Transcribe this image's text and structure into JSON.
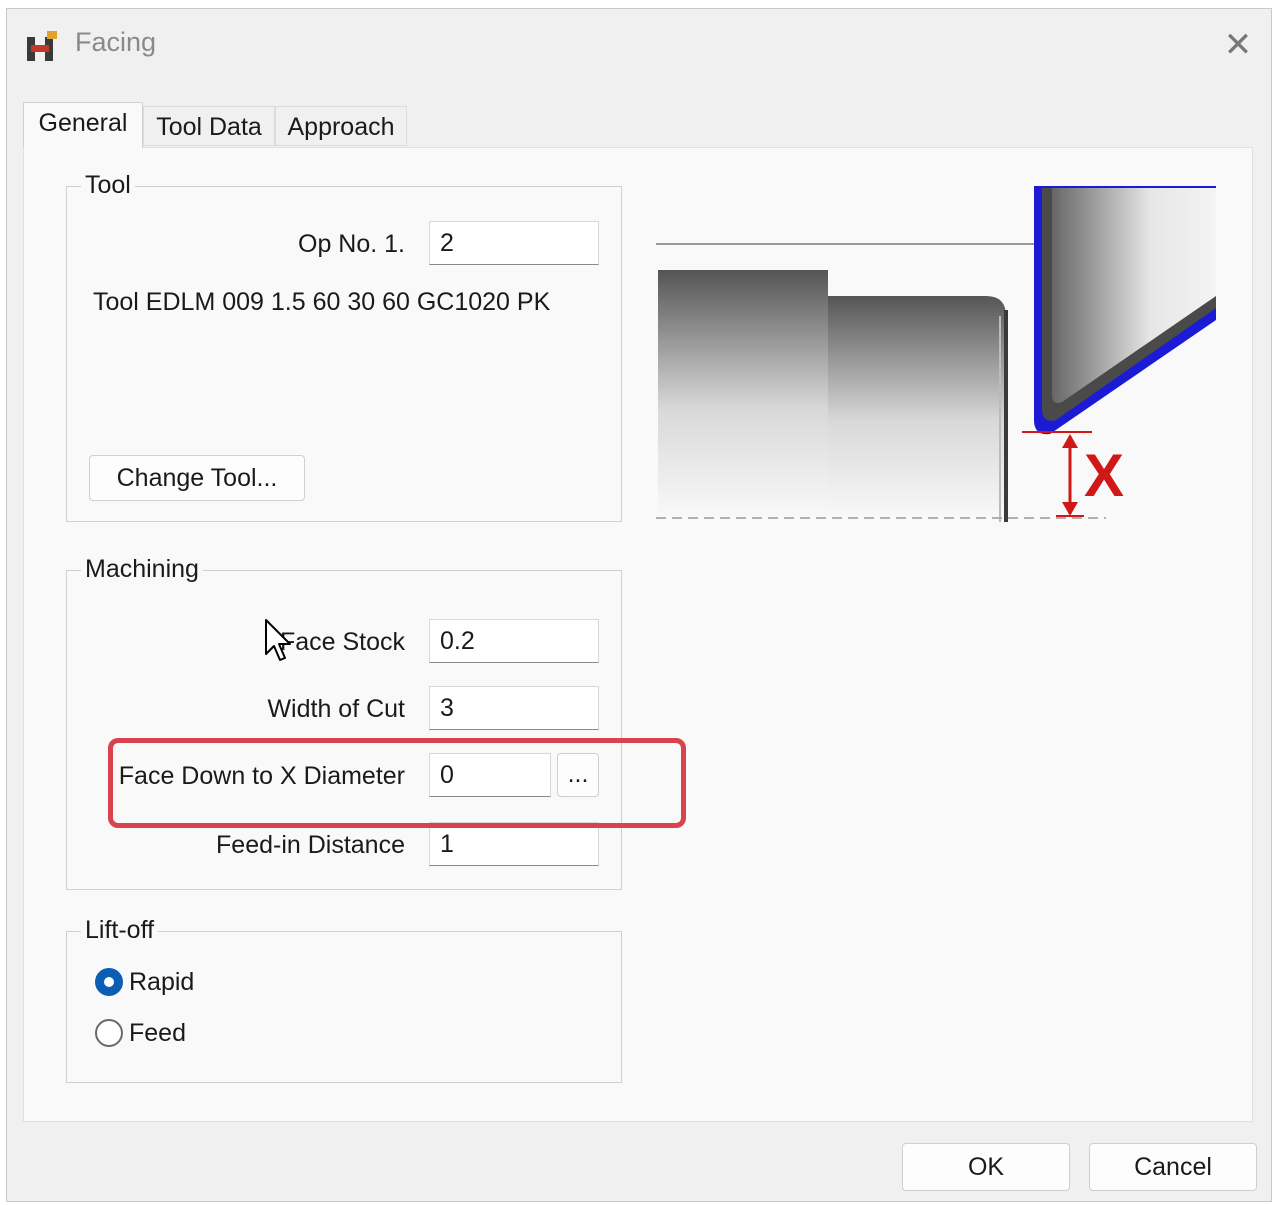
{
  "window": {
    "title": "Facing",
    "close_glyph": "✕"
  },
  "tabs": [
    {
      "label": "General",
      "active": true
    },
    {
      "label": "Tool Data",
      "active": false
    },
    {
      "label": "Approach",
      "active": false
    }
  ],
  "tool_group": {
    "title": "Tool",
    "op_no_label": "Op No. 1.",
    "op_no_value": "2",
    "tool_description": "Tool EDLM 009 1.5 60 30 60 GC1020 PK",
    "change_tool_label": "Change Tool..."
  },
  "machining_group": {
    "title": "Machining",
    "face_stock_label": "Face Stock",
    "face_stock_value": "0.2",
    "width_of_cut_label": "Width of Cut",
    "width_of_cut_value": "3",
    "face_down_label": "Face Down to X Diameter",
    "face_down_value": "0",
    "browse_label": "...",
    "feed_in_label": "Feed-in Distance",
    "feed_in_value": "1"
  },
  "liftoff_group": {
    "title": "Lift-off",
    "options": [
      {
        "label": "Rapid",
        "selected": true
      },
      {
        "label": "Feed",
        "selected": false
      }
    ]
  },
  "diagram": {
    "dimension_label": "X",
    "accent_color": "#d01818",
    "tool_color": "#0a14d0"
  },
  "footer": {
    "ok_label": "OK",
    "cancel_label": "Cancel"
  }
}
